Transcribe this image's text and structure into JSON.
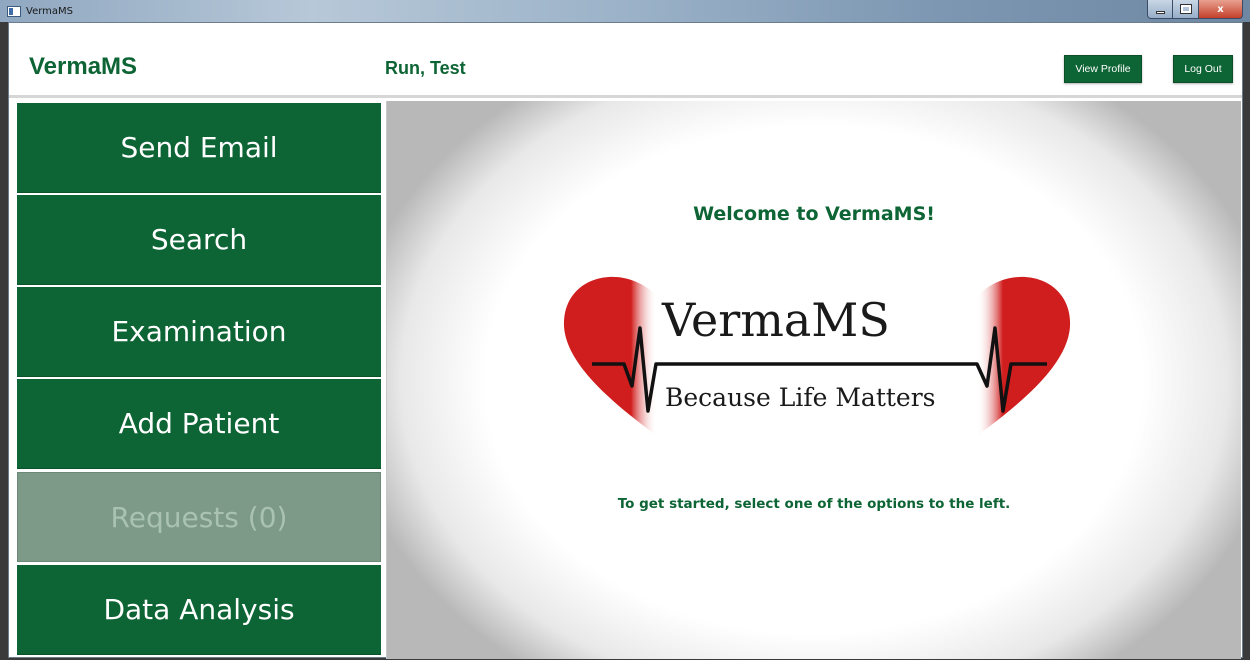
{
  "window": {
    "title": "VermaMS",
    "controls": {
      "minimize": "minimize-icon",
      "maximize": "maximize-icon",
      "close": "x"
    }
  },
  "header": {
    "brand": "VermaMS",
    "user_name": "Run, Test",
    "view_profile_label": "View Profile",
    "logout_label": "Log Out"
  },
  "sidebar": {
    "items": [
      {
        "label": "Send Email",
        "enabled": true
      },
      {
        "label": "Search",
        "enabled": true
      },
      {
        "label": "Examination",
        "enabled": true
      },
      {
        "label": "Add Patient",
        "enabled": true
      },
      {
        "label": "Requests (0)",
        "enabled": false
      },
      {
        "label": "Data Analysis",
        "enabled": true
      }
    ]
  },
  "main": {
    "welcome": "Welcome to VermaMS!",
    "logo": {
      "title": "VermaMS",
      "tagline": "Because Life Matters"
    },
    "instructions": "To get started, select one of the options to the left."
  },
  "colors": {
    "brand_green": "#0d6434",
    "disabled_green": "#7c9a87",
    "heart_red": "#d01d1d"
  }
}
